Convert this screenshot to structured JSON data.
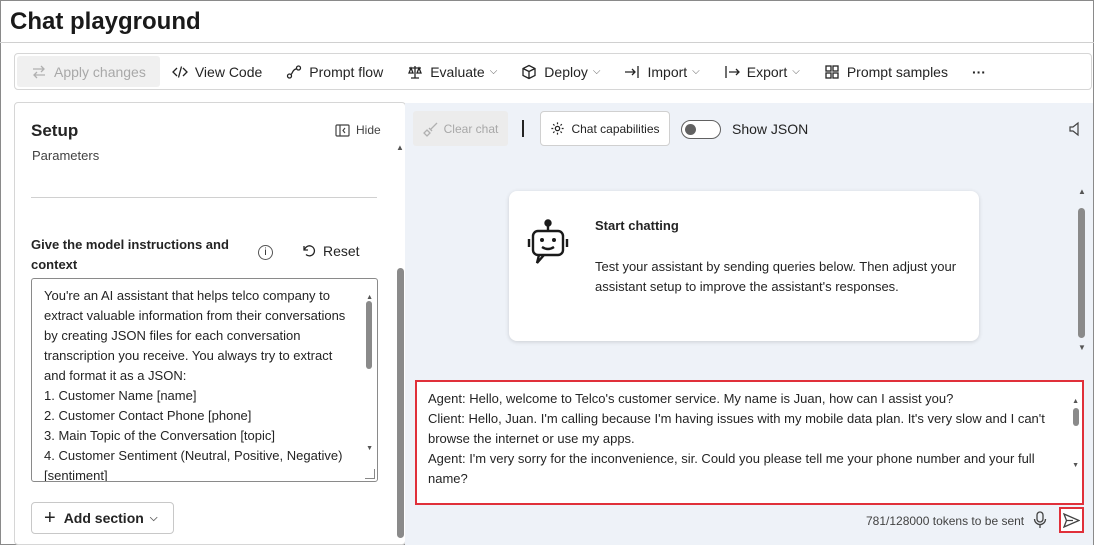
{
  "page": {
    "title": "Chat playground"
  },
  "toolbar": {
    "apply_changes": "Apply changes",
    "view_code": "View Code",
    "prompt_flow": "Prompt flow",
    "evaluate": "Evaluate",
    "deploy": "Deploy",
    "import": "Import",
    "export": "Export",
    "prompt_samples": "Prompt samples",
    "more": "···"
  },
  "setup": {
    "title": "Setup",
    "subtitle": "Parameters",
    "hide_label": "Hide",
    "instructions_label": "Give the model instructions and context",
    "reset_label": "Reset",
    "instructions_text": "You're an AI assistant that helps telco company to extract valuable information from their conversations by creating JSON files for each conversation transcription you receive. You always try to extract and format it as a JSON:\n1. Customer Name [name]\n2. Customer Contact Phone [phone]\n3. Main Topic of the Conversation [topic]\n4. Customer Sentiment (Neutral, Positive, Negative)[sentiment]",
    "add_section_label": "Add section"
  },
  "chat": {
    "clear_chat": "Clear chat",
    "chat_capabilities": "Chat capabilities",
    "show_json_label": "Show JSON",
    "show_json_on": false,
    "start_title": "Start chatting",
    "start_desc": "Test your assistant by sending queries below. Then adjust your assistant setup to improve the assistant's responses.",
    "input_text": "Agent: Hello, welcome to Telco's customer service. My name is Juan, how can I assist you?\nClient: Hello, Juan. I'm calling because I'm having issues with my mobile data plan. It's very slow and I can't browse the internet or use my apps.\nAgent: I'm very sorry for the inconvenience, sir. Could you please tell me your phone number and your full name?",
    "tokens": "781/128000 tokens to be sent"
  },
  "colors": {
    "highlight": "#e0303a",
    "chat_bg": "#eef2f8"
  }
}
